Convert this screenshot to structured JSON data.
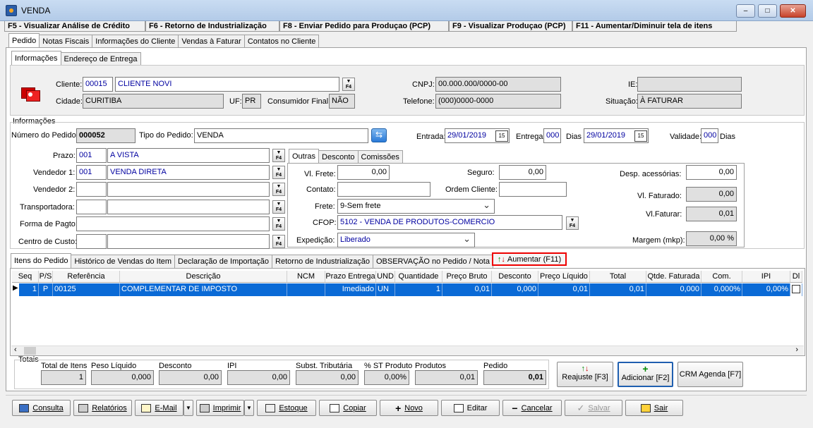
{
  "window": {
    "title": "VENDA",
    "min": "–",
    "max": "□",
    "close": "✕"
  },
  "fkeys": [
    "F5 - Visualizar Análise de Crédito",
    "F6 - Retorno de Industrialização",
    "F8 - Enviar Pedido para Produçao (PCP)",
    "F9 - Visualizar Produçao (PCP)",
    "F11 - Aumentar/Diminuir tela de itens"
  ],
  "tabs_main": [
    "Pedido",
    "Notas Fiscais",
    "Informações do Cliente",
    "Vendas à Faturar",
    "Contatos no Cliente"
  ],
  "tabs_info": [
    "Informações",
    "Endereço de Entrega"
  ],
  "client": {
    "cliente_label": "Cliente:",
    "cliente_code": "00015",
    "cliente_name": "CLIENTE NOVI",
    "cidade_label": "Cidade:",
    "cidade": "CURITIBA",
    "uf_label": "UF:",
    "uf": "PR",
    "cf_label": "Consumidor Final:",
    "cf": "NÃO",
    "cnpj_label": "CNPJ:",
    "cnpj": "00.000.000/0000-00",
    "tel_label": "Telefone:",
    "tel": "(000)0000-0000",
    "ie_label": "IE:",
    "ie": "",
    "sit_label": "Situação:",
    "sit": "À FATURAR"
  },
  "info": {
    "group": "Informações",
    "num_label": "Número do Pedido:",
    "num": "000052",
    "tipo_label": "Tipo do Pedido:",
    "tipo": "VENDA",
    "entrada_label": "Entrada:",
    "entrada": "29/01/2019",
    "entrega_label": "Entrega:",
    "entrega": "000",
    "dias_label": "Dias",
    "entrega_date": "29/01/2019",
    "validade_label": "Validade:",
    "validade": "000",
    "dias2_label": "Dias"
  },
  "left": {
    "prazo_label": "Prazo:",
    "prazo_code": "001",
    "prazo": "A VISTA",
    "vend1_label": "Vendedor 1:",
    "vend1_code": "001",
    "vend1": "VENDA DIRETA",
    "vend2_label": "Vendedor 2:",
    "transp_label": "Transportadora:",
    "forma_label": "Forma de Pagto:",
    "centro_label": "Centro de Custo:"
  },
  "tabs_outras": [
    "Outras",
    "Desconto",
    "Comissões"
  ],
  "outras": {
    "frete_label": "Vl. Frete:",
    "frete": "0,00",
    "seguro_label": "Seguro:",
    "seguro": "0,00",
    "contato_label": "Contato:",
    "ordem_label": "Ordem Cliente:",
    "frete_tipo_label": "Frete:",
    "frete_tipo": "9-Sem frete",
    "cfop_label": "CFOP:",
    "cfop": "5102 - VENDA DE PRODUTOS-COMERCIO",
    "exp_label": "Expedição:",
    "exp": "Liberado"
  },
  "right": {
    "desp_label": "Desp. acessórias:",
    "desp": "0,00",
    "vfat_label": "Vl. Faturado:",
    "vfat": "0,00",
    "vafat_label": "Vl.Faturar:",
    "vafat": "0,01",
    "margem_label": "Margem (mkp):",
    "margem": "0,00 %"
  },
  "tabs_items": [
    "Itens do Pedido",
    "Histórico de Vendas do Item",
    "Declaração de Importação",
    "Retorno de Industrialização",
    "OBSERVAÇÃO no Pedido / Nota"
  ],
  "aumentar": "Aumentar (F11)",
  "grid": {
    "headers": [
      "Seq",
      "P/S",
      "Referência",
      "Descrição",
      "NCM",
      "Prazo Entrega",
      "UND",
      "Quantidade",
      "Preço Bruto",
      "Desconto",
      "Preço Líquido",
      "Total",
      "Qtde. Faturada",
      "Com.",
      "IPI",
      "Dl"
    ],
    "row": [
      "1",
      "P",
      "00125",
      "COMPLEMENTAR DE IMPOSTO",
      "",
      "Imediado",
      "UN",
      "1",
      "0,01",
      "0,000",
      "0,01",
      "0,01",
      "0,000",
      "0,000%",
      "0,00%"
    ]
  },
  "totais": {
    "group": "Totais",
    "labels": [
      "Total de Itens",
      "Peso Líquido",
      "Desconto",
      "IPI",
      "Subst. Tributária",
      "% ST Produto",
      "Produtos",
      "Pedido"
    ],
    "values": [
      "1",
      "0,000",
      "0,00",
      "0,00",
      "0,00",
      "0,00%",
      "0,01",
      "0,01"
    ]
  },
  "actions": {
    "reajuste": "Reajuste [F3]",
    "adicionar": "Adicionar [F2]",
    "crm": "CRM Agenda [F7]"
  },
  "toolbar": [
    "Consulta",
    "Relatórios",
    "E-Mail",
    "Imprimir",
    "Estoque",
    "Copiar",
    "Novo",
    "Editar",
    "Cancelar",
    "Salvar",
    "Sair"
  ]
}
